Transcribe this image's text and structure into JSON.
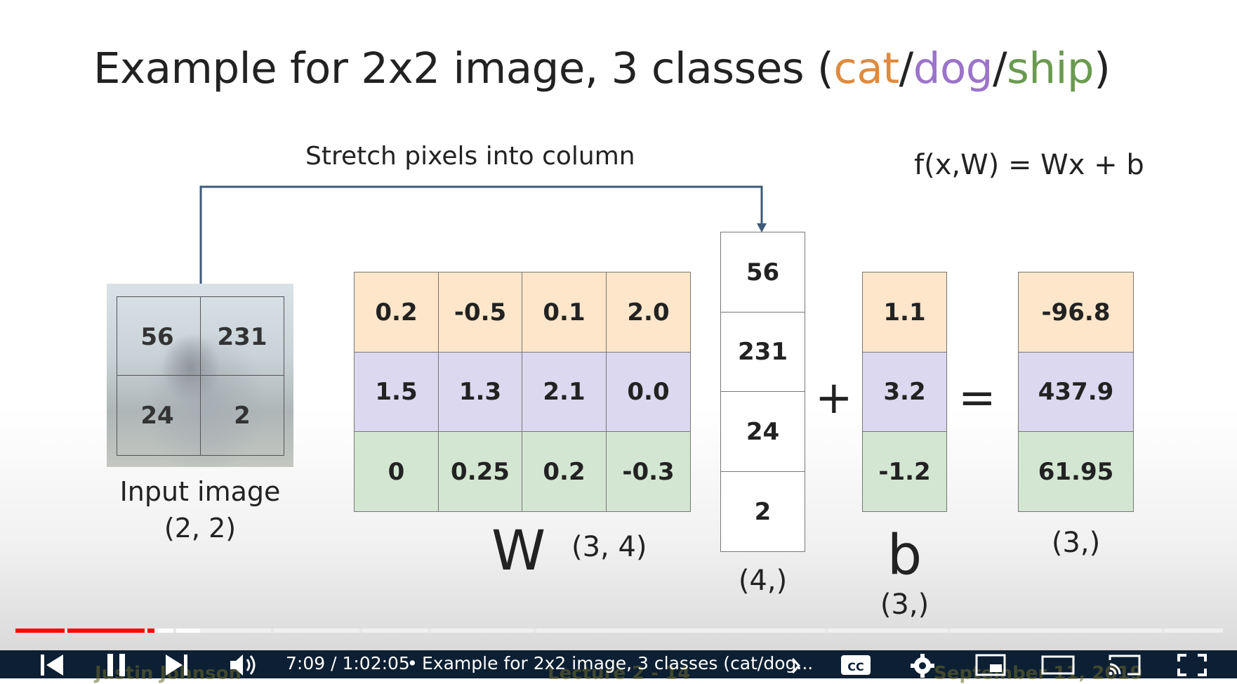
{
  "slide": {
    "title_prefix": "Example for 2x2 image, 3 classes (",
    "title_cat": "cat",
    "title_sep1": "/",
    "title_dog": "dog",
    "title_sep2": "/",
    "title_ship": "ship",
    "title_suffix": ")",
    "stretch_label": "Stretch pixels into column",
    "formula": "f(x,W) = Wx + b",
    "input_pixels": [
      "56",
      "231",
      "24",
      "2"
    ],
    "input_label": "Input image",
    "input_shape": "(2, 2)",
    "W_rows": [
      [
        "0.2",
        "-0.5",
        "0.1",
        "2.0"
      ],
      [
        "1.5",
        "1.3",
        "2.1",
        "0.0"
      ],
      [
        "0",
        "0.25",
        "0.2",
        "-0.3"
      ]
    ],
    "W_label": "W",
    "W_shape": "(3, 4)",
    "x_column": [
      "56",
      "231",
      "24",
      "2"
    ],
    "x_shape": "(4,)",
    "plus": "+",
    "b_values": [
      "1.1",
      "3.2",
      "-1.2"
    ],
    "b_label": "b",
    "b_shape": "(3,)",
    "equals": "=",
    "result_values": [
      "-96.8",
      "437.9",
      "61.95"
    ],
    "result_shape": "(3,)",
    "colors": {
      "cat": "#e08a3c",
      "dog": "#9b74c9",
      "ship": "#6a9a4f",
      "row0": "#fde6c9",
      "row1": "#dcd8ef",
      "row2": "#d3e6d1"
    }
  },
  "player": {
    "time": "7:09 / 1:02:05",
    "separator": "•",
    "chapter_title": "Example for 2x2 image, 3 classes (cat/dog...",
    "progress_fraction": 0.115,
    "overlay_text_left": "Justin Johnson",
    "overlay_text_mid": "Lecture 2 - 14",
    "overlay_text_right": "September 11, 2019",
    "icons": [
      "previous-icon",
      "pause-icon",
      "next-icon",
      "volume-icon",
      "chevron-right-icon",
      "captions-icon",
      "settings-icon",
      "miniplayer-icon",
      "theater-icon",
      "cast-icon",
      "fullscreen-icon"
    ]
  }
}
